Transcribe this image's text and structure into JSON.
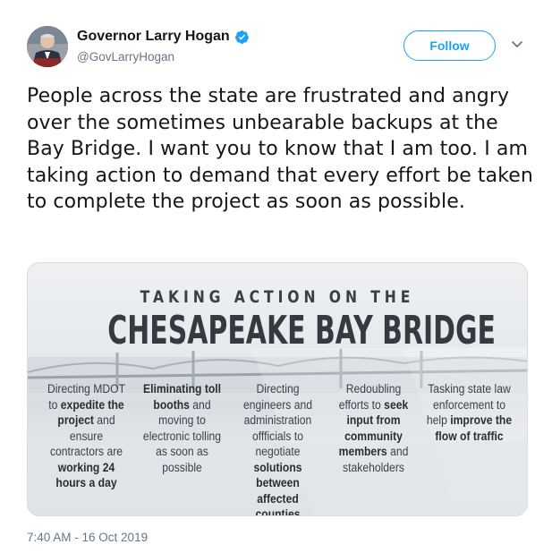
{
  "author": {
    "name": "Governor Larry Hogan",
    "handle": "@GovLarryHogan",
    "verified": true,
    "avatar_icon": "avatar-photo-icon"
  },
  "actions": {
    "follow_label": "Follow",
    "more_icon": "chevron-down-icon"
  },
  "tweet": {
    "text": "People across the state are frustrated and angry over the sometimes unbearable backups at the Bay Bridge. I want you to know that I am too. I am taking action to demand that every effort be taken to complete the project as soon as possible.",
    "timestamp": "7:40 AM - 16 Oct 2019"
  },
  "media": {
    "kicker": "TAKING ACTION ON THE",
    "headline": "CHESAPEAKE BAY BRIDGE",
    "columns": [
      [
        {
          "t": "Directing MDOT to ",
          "b": false
        },
        {
          "t": "expedite the project",
          "b": true
        },
        {
          "t": " and ensure contractors are ",
          "b": false
        },
        {
          "t": "working 24 hours a day",
          "b": true
        }
      ],
      [
        {
          "t": "Eliminating toll booths",
          "b": true
        },
        {
          "t": " and moving to electronic tolling as soon as possible",
          "b": false
        }
      ],
      [
        {
          "t": "Directing engineers and administration offficials to negotiate ",
          "b": false
        },
        {
          "t": "solutions between affected counties",
          "b": true
        }
      ],
      [
        {
          "t": "Redoubling efforts to ",
          "b": false
        },
        {
          "t": "seek input from community members",
          "b": true
        },
        {
          "t": " and stakeholders",
          "b": false
        }
      ],
      [
        {
          "t": "Tasking state law enforcement to help ",
          "b": false
        },
        {
          "t": "improve the flow of traffic",
          "b": true
        }
      ]
    ]
  },
  "colors": {
    "accent": "#1da1f2",
    "muted": "#657786",
    "text": "#14171a"
  }
}
